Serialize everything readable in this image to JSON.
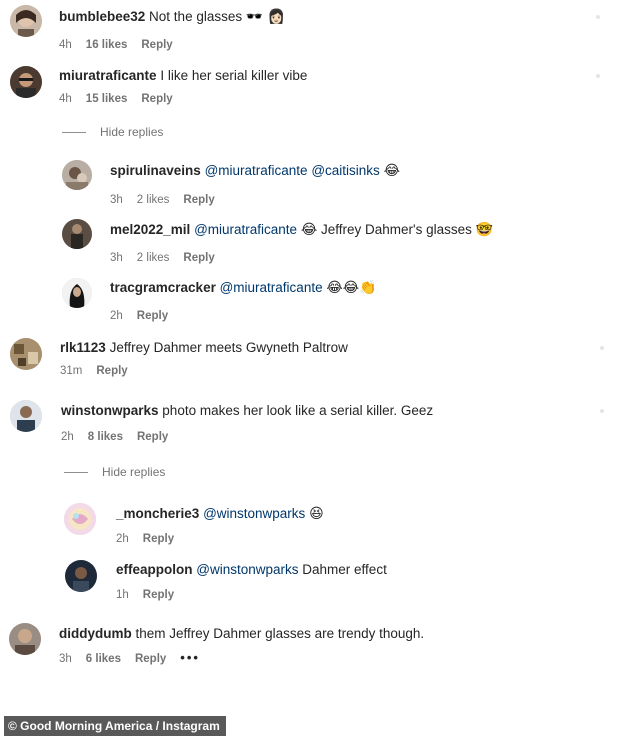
{
  "comments": [
    {
      "user": "bumblebee32",
      "text": "Not the glasses",
      "emoji": "🕶️ 👩🏻",
      "time": "4h",
      "likes": "16 likes",
      "reply": "Reply"
    },
    {
      "user": "miuratraficante",
      "text": "I like her serial killer vibe",
      "time": "4h",
      "likes": "15 likes",
      "reply": "Reply",
      "hide_replies": "Hide replies"
    },
    {
      "user": "spirulinaveins",
      "mention1": "@miuratraficante",
      "mention2": "@caitisinks",
      "emoji": "😂",
      "time": "3h",
      "likes": "2 likes",
      "reply": "Reply"
    },
    {
      "user": "mel2022_mil",
      "mention1": "@miuratraficante",
      "emoji1": "😂",
      "text": "Jeffrey Dahmer's glasses",
      "emoji2": "🤓",
      "time": "3h",
      "likes": "2 likes",
      "reply": "Reply"
    },
    {
      "user": "tracgramcracker",
      "mention1": "@miuratraficante",
      "emoji": "😂😂👏",
      "time": "2h",
      "reply": "Reply"
    },
    {
      "user": "rlk1123",
      "text": "Jeffrey Dahmer meets Gwyneth Paltrow",
      "time": "31m",
      "reply": "Reply"
    },
    {
      "user": "winstonwparks",
      "text": "photo makes her look like a serial killer. Geez",
      "time": "2h",
      "likes": "8 likes",
      "reply": "Reply",
      "hide_replies": "Hide replies"
    },
    {
      "user": "_moncherie3",
      "mention1": "@winstonwparks",
      "emoji": "😆",
      "time": "2h",
      "reply": "Reply"
    },
    {
      "user": "effeappolon",
      "mention1": "@winstonwparks",
      "text": "Dahmer effect",
      "time": "1h",
      "reply": "Reply"
    },
    {
      "user": "diddydumb",
      "text": "them Jeffrey Dahmer glasses are trendy though.",
      "time": "3h",
      "likes": "6 likes",
      "reply": "Reply",
      "more": "•••"
    }
  ],
  "credit": "© Good Morning America / Instagram",
  "colors": {
    "mention": "#00376b",
    "meta": "#737373",
    "credit_bg": "#595959"
  }
}
